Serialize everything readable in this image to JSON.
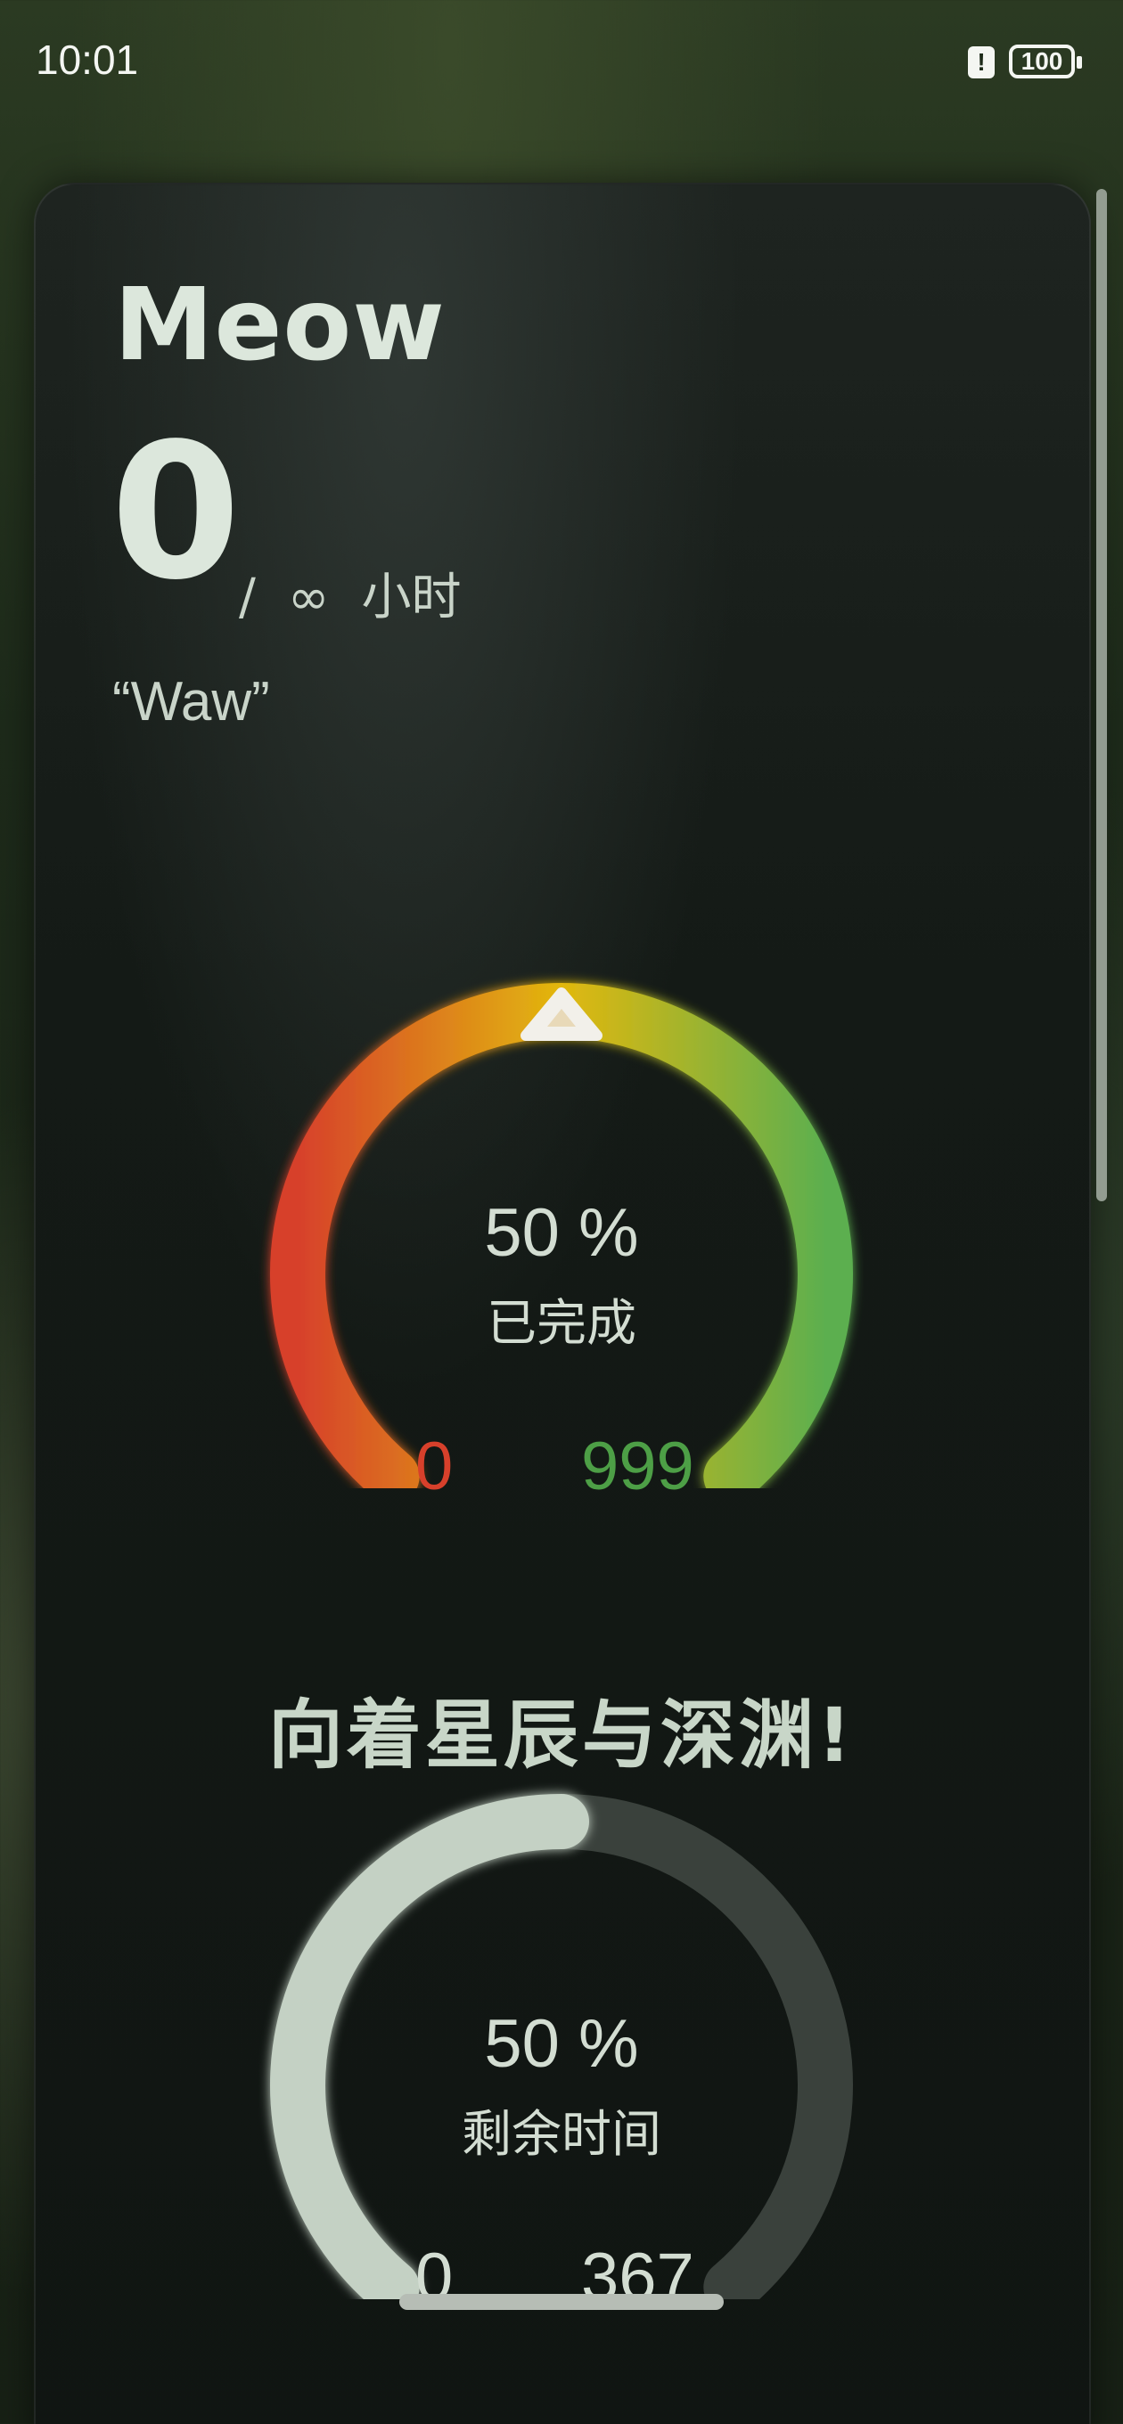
{
  "status_bar": {
    "time": "10:01",
    "alert_glyph": "!",
    "battery": "100"
  },
  "header": {
    "title": "Meow",
    "count": "0",
    "suffix_slash": "/",
    "suffix_infinity": "∞",
    "suffix_unit": "小时",
    "quote": "“Waw”"
  },
  "progress_gauge": {
    "percent": 0.5,
    "value_text": "50 %",
    "label": "已完成",
    "min": "0",
    "max": "999",
    "colors": {
      "start": "#d7402b",
      "mid": "#e2b80e",
      "end": "#5caf4f",
      "min_text": "#d7402b",
      "max_text": "#4d9f46"
    }
  },
  "motto": "向着星辰与深渊!",
  "remaining_gauge": {
    "percent": 0.5,
    "value_text": "50 %",
    "label": "剩余时间",
    "min": "0",
    "max": "367",
    "colors": {
      "filled": "#c4d1c4",
      "track": "#3a413c",
      "text": "#d3ddd2"
    }
  }
}
